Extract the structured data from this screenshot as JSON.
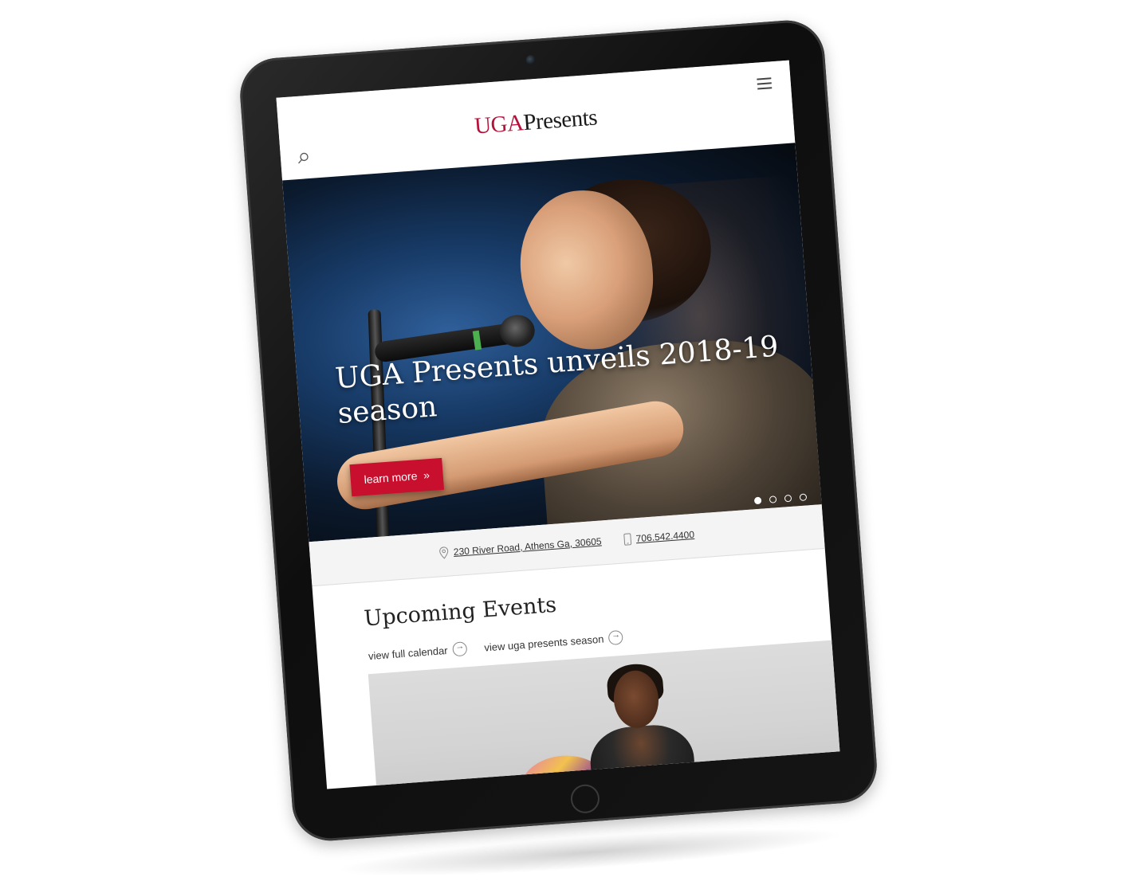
{
  "header": {
    "logo_primary": "UGA",
    "logo_secondary": "Presents"
  },
  "hero": {
    "title": "UGA Presents unveils 2018-19 season",
    "cta_label": "learn more",
    "cta_glyph": "»",
    "slide_count": 4,
    "active_slide": 1
  },
  "contact": {
    "address": "230 River Road, Athens Ga, 30605",
    "phone": "706.542.4400"
  },
  "events": {
    "title": "Upcoming Events",
    "calendar_link": "view full calendar",
    "season_link": "view uga presents season"
  },
  "colors": {
    "brand_red": "#c8102e",
    "logo_red": "#b5123a"
  },
  "icons": [
    "menu-icon",
    "search-icon",
    "location-pin-icon",
    "phone-icon",
    "arrow-right-circle-icon"
  ]
}
